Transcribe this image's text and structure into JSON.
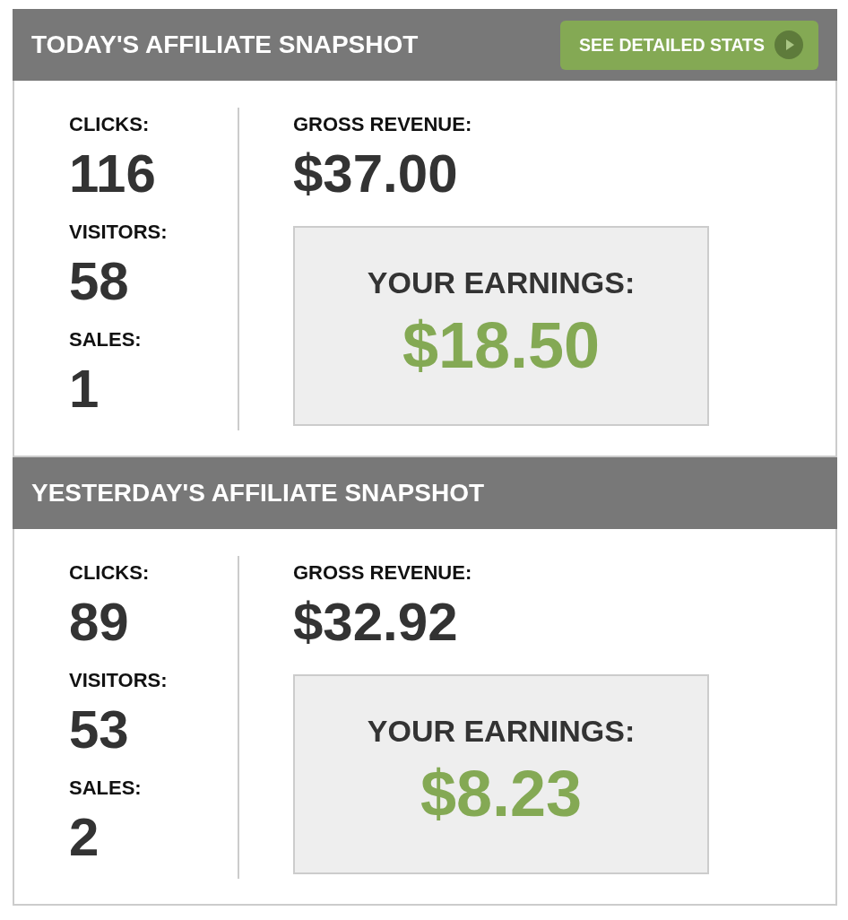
{
  "panels": [
    {
      "title": "TODAY'S AFFILIATE SNAPSHOT",
      "button": {
        "label": "SEE DETAILED STATS"
      },
      "stats": [
        {
          "label": "CLICKS:",
          "value": "116"
        },
        {
          "label": "VISITORS:",
          "value": "58"
        },
        {
          "label": "SALES:",
          "value": "1"
        }
      ],
      "gross_revenue": {
        "label": "GROSS REVENUE:",
        "value": "$37.00"
      },
      "earnings": {
        "label": "YOUR EARNINGS:",
        "value": "$18.50"
      }
    },
    {
      "title": "YESTERDAY'S AFFILIATE SNAPSHOT",
      "stats": [
        {
          "label": "CLICKS:",
          "value": "89"
        },
        {
          "label": "VISITORS:",
          "value": "53"
        },
        {
          "label": "SALES:",
          "value": "2"
        }
      ],
      "gross_revenue": {
        "label": "GROSS REVENUE:",
        "value": "$32.92"
      },
      "earnings": {
        "label": "YOUR EARNINGS:",
        "value": "$8.23"
      }
    }
  ]
}
